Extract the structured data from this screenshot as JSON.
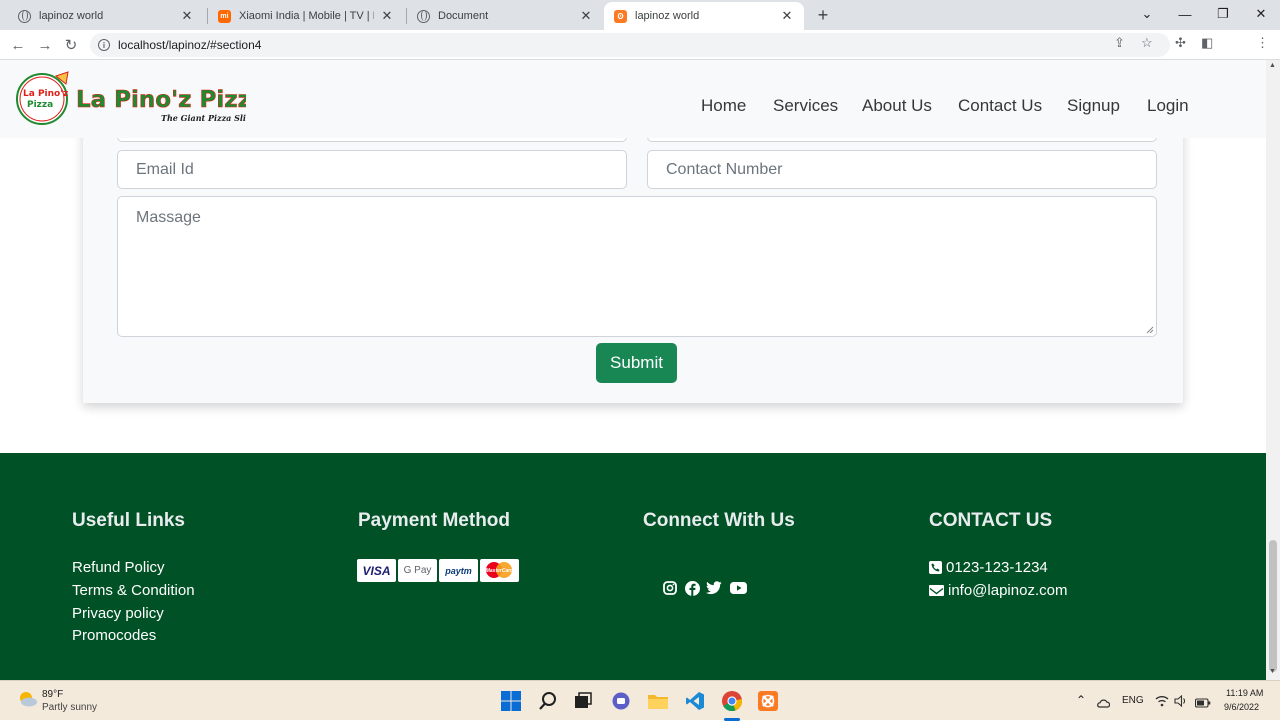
{
  "browser": {
    "tabs": [
      {
        "title": "lapinoz world",
        "icon": "globe-icon",
        "active": false
      },
      {
        "title": "Xiaomi India | Mobile | TV | Fitnes",
        "icon": "mi-icon",
        "active": false
      },
      {
        "title": "Document",
        "icon": "globe-icon",
        "active": false
      },
      {
        "title": "lapinoz world",
        "icon": "xampp-icon",
        "active": true
      }
    ],
    "new_tab": "+",
    "url": "localhost/lapinoz/#section4"
  },
  "navbar": {
    "logo_text": "La Pino'z Pizza",
    "logo_tagline": "The Giant Pizza Slices",
    "logo_badge_top": "La Pino'z",
    "logo_badge_bottom": "Pizza",
    "links": [
      "Home",
      "Services",
      "About Us",
      "Contact Us",
      "Signup",
      "Login"
    ]
  },
  "contact_form": {
    "email_placeholder": "Email Id",
    "contact_placeholder": "Contact Number",
    "message_placeholder": "Massage",
    "submit_label": "Submit"
  },
  "footer": {
    "useful_links": {
      "heading": "Useful Links",
      "items": [
        "Refund Policy",
        "Terms & Condition",
        "Privacy policy",
        "Promocodes"
      ]
    },
    "payment": {
      "heading": "Payment Method",
      "cards": [
        "VISA",
        "G Pay",
        "paytm",
        "MasterCard"
      ]
    },
    "connect": {
      "heading": "Connect With Us",
      "icons": [
        "instagram-icon",
        "facebook-icon",
        "twitter-icon",
        "youtube-icon"
      ]
    },
    "contact": {
      "heading": "CONTACT US",
      "phone": "0123-123-1234",
      "email": "info@lapinoz.com"
    }
  },
  "taskbar": {
    "weather_temp": "89°F",
    "weather_desc": "Partly sunny",
    "lang": "ENG",
    "time": "11:19 AM",
    "date": "9/6/2022"
  },
  "colors": {
    "footer_bg": "#005226",
    "submit_bg": "#198754",
    "logo_green": "#1f8a2f",
    "logo_red": "#e0201b"
  }
}
